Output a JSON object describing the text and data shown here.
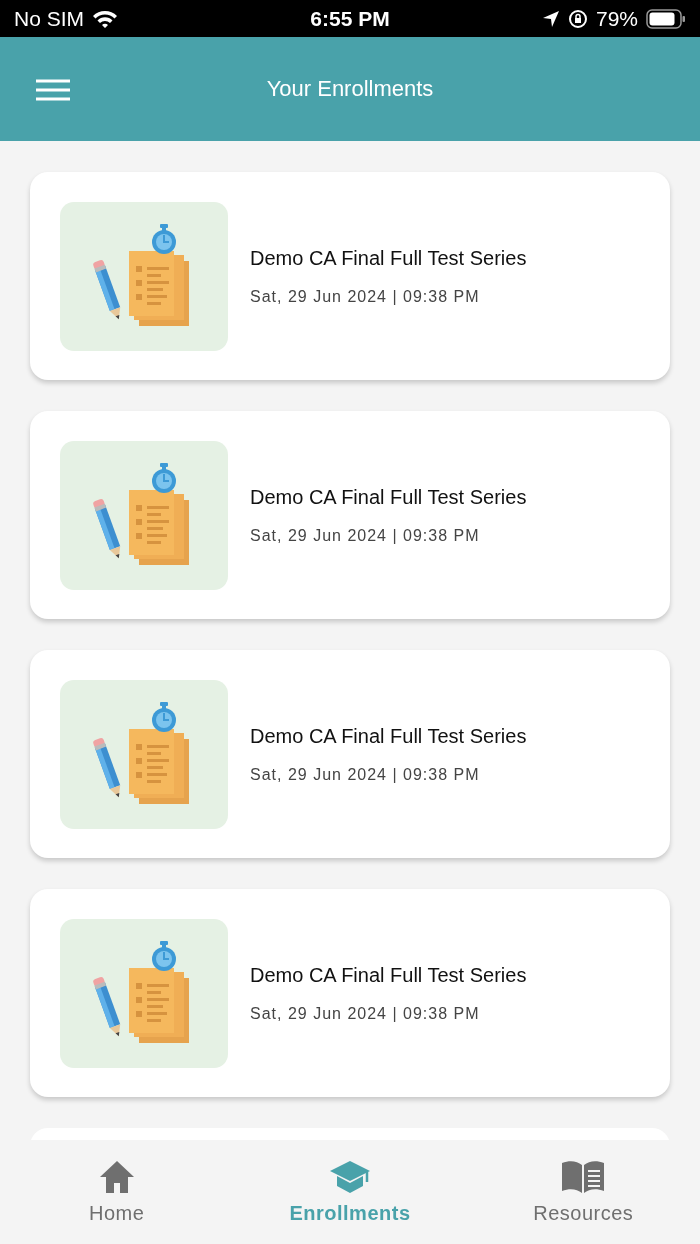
{
  "status_bar": {
    "carrier": "No SIM",
    "time": "6:55 PM",
    "battery": "79%"
  },
  "header": {
    "title": "Your Enrollments"
  },
  "enrollments": [
    {
      "title": "Demo CA Final Full Test Series",
      "date": "Sat, 29 Jun 2024 | 09:38 PM"
    },
    {
      "title": "Demo CA Final Full Test Series",
      "date": "Sat, 29 Jun 2024 | 09:38 PM"
    },
    {
      "title": "Demo CA Final Full Test Series",
      "date": "Sat, 29 Jun 2024 | 09:38 PM"
    },
    {
      "title": "Demo CA Final Full Test Series",
      "date": "Sat, 29 Jun 2024 | 09:38 PM"
    }
  ],
  "tab_bar": [
    {
      "label": "Home",
      "kind": "home",
      "selected": false
    },
    {
      "label": "Enrollments",
      "kind": "courses",
      "selected": true
    },
    {
      "label": "Resources",
      "kind": "library",
      "selected": false
    }
  ]
}
